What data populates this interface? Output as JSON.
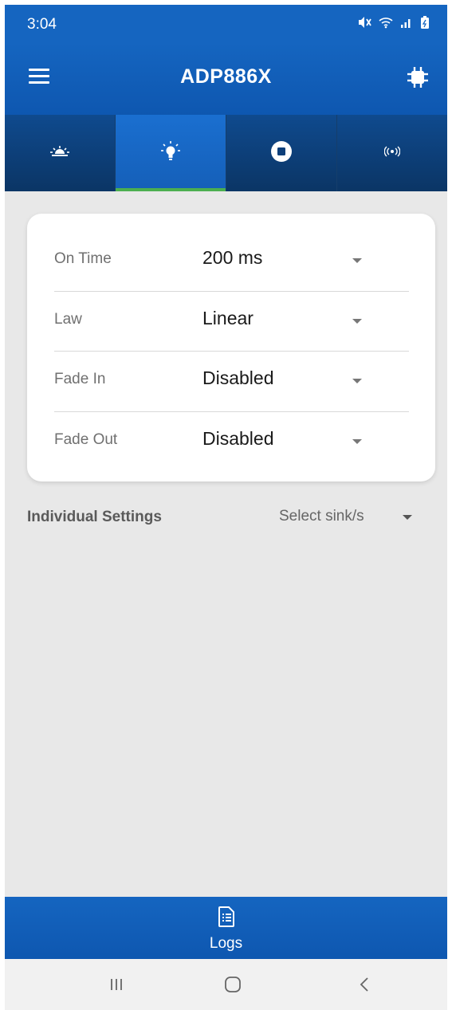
{
  "status_bar": {
    "time": "3:04",
    "icons": [
      "mute-icon",
      "wifi-icon",
      "signal-icon",
      "battery-icon"
    ]
  },
  "app_bar": {
    "title": "ADP886X",
    "left_icon": "menu-icon",
    "right_icon": "chip-icon"
  },
  "tabs": [
    {
      "icon": "sunrise-icon",
      "active": false
    },
    {
      "icon": "lightbulb-icon",
      "active": true
    },
    {
      "icon": "stop-icon",
      "active": false
    },
    {
      "icon": "broadcast-icon",
      "active": false
    }
  ],
  "settings": [
    {
      "label": "On Time",
      "value": "200 ms"
    },
    {
      "label": "Law",
      "value": "Linear"
    },
    {
      "label": "Fade In",
      "value": "Disabled"
    },
    {
      "label": "Fade Out",
      "value": "Disabled"
    }
  ],
  "individual": {
    "label": "Individual Settings",
    "select_value": "Select sink/s"
  },
  "bottom_bar": {
    "icon": "logs-icon",
    "label": "Logs"
  },
  "nav_bar": {
    "buttons": [
      "recent-apps-icon",
      "home-icon",
      "back-icon"
    ]
  },
  "colors": {
    "primary": "#1565c0",
    "tab_dark": "#0b3565",
    "tab_active_indicator": "#4caf50",
    "background": "#e8e8e8"
  }
}
